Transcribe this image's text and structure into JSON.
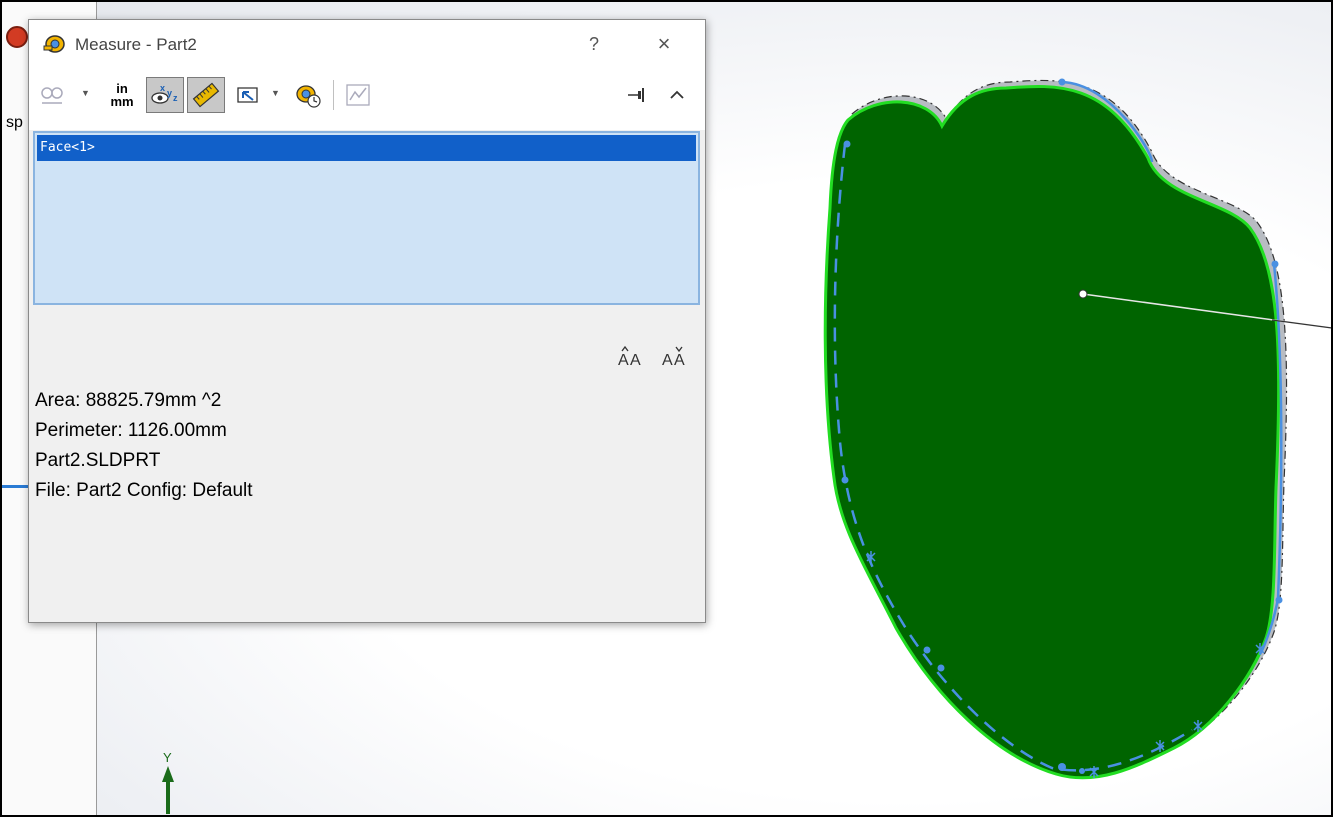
{
  "dialog": {
    "title": "Measure - Part2",
    "help_label": "?",
    "close_label": "×",
    "toolbar": {
      "units_top": "in",
      "units_bottom": "mm",
      "pressed": [
        "show-xyz-button",
        "point-to-point-button"
      ],
      "icons": [
        "arc-circle-icon",
        "units-icon",
        "xyz-eye-icon",
        "ruler-icon",
        "projection-icon",
        "history-icon",
        "sensor-icon",
        "pin-icon",
        "collapse-icon"
      ]
    },
    "selection": {
      "items": [
        "Face<1>"
      ]
    },
    "results": {
      "area": "Area: 88825.79mm ^2",
      "perimeter": "Perimeter: 1126.00mm",
      "file": "Part2.SLDPRT",
      "config": "File: Part2 Config: Default"
    }
  },
  "side_panel": {
    "fragment": "sp"
  },
  "triad": {
    "axis_label": "Y"
  },
  "colors": {
    "face_fill": "#006400",
    "face_edge": "#22dd22",
    "sketch": "#4a90e2",
    "selection_row": "#1160c9",
    "selection_bg": "#cfe3f6"
  }
}
